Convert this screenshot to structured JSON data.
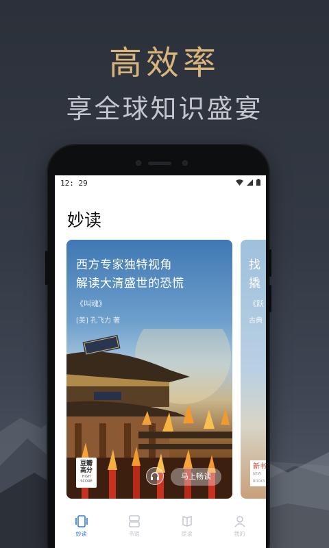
{
  "promo": {
    "title": "高效率",
    "subtitle": "享全球知识盛宴"
  },
  "status_bar": {
    "time": "12: 29",
    "icons": [
      "wifi-icon",
      "signal-icon",
      "battery-icon"
    ]
  },
  "page": {
    "title": "妙读"
  },
  "featured_card": {
    "headline_line1": "西方专家独特视角",
    "headline_line2": "解读大清盛世的恐慌",
    "book_title": "《叫魂》",
    "author": "[美] 孔飞力 著",
    "badge_line1": "豆瓣",
    "badge_line2": "高分",
    "badge_small1": "HIGH",
    "badge_small2": "SCORE",
    "read_button": "马上畅读",
    "audio_icon": "headphones-icon"
  },
  "next_card": {
    "headline_line1": "找",
    "headline_line2": "撬",
    "book_title": "《跃",
    "author": "古典",
    "badge_line1": "新书",
    "badge_small1": "NEW",
    "badge_small2": "BOOKS"
  },
  "tabs": [
    {
      "label": "妙读",
      "icon": "book-card-icon",
      "active": true
    },
    {
      "label": "书馆",
      "icon": "library-icon",
      "active": false
    },
    {
      "label": "提读",
      "icon": "flag-icon",
      "active": false
    },
    {
      "label": "我的",
      "icon": "person-icon",
      "active": false
    }
  ],
  "colors": {
    "accent": "#2c7be5",
    "promo_title": "#d8b57c",
    "background": "#2b3039"
  }
}
